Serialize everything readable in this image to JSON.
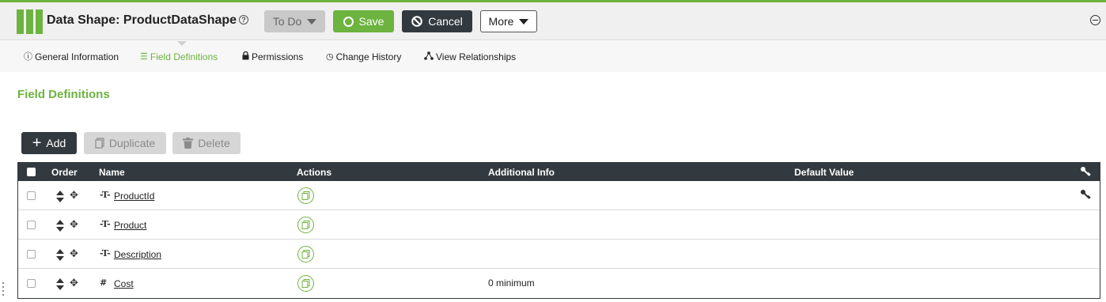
{
  "header": {
    "title": "Data Shape: ProductDataShape",
    "help_glyph": "?",
    "state_label": "To Do",
    "save_label": "Save",
    "cancel_label": "Cancel",
    "more_label": "More",
    "accent": "#6db33f",
    "dark": "#333a3f"
  },
  "tabs": [
    {
      "label": "General Information",
      "icon": "info-icon",
      "glyph": "ⓘ"
    },
    {
      "label": "Field Definitions",
      "icon": "list-icon",
      "glyph": "☰",
      "active": true
    },
    {
      "label": "Permissions",
      "icon": "lock-icon",
      "glyph": "🔒"
    },
    {
      "label": "Change History",
      "icon": "clock-icon",
      "glyph": "◷"
    },
    {
      "label": "View Relationships",
      "icon": "relationship-icon",
      "glyph": "⛓"
    }
  ],
  "section": {
    "title": "Field Definitions"
  },
  "actions": {
    "add_label": "Add",
    "duplicate_label": "Duplicate",
    "delete_label": "Delete"
  },
  "grid": {
    "columns": [
      "Order",
      "Name",
      "Actions",
      "Additional Info",
      "Default Value"
    ],
    "rows": [
      {
        "name": "ProductId",
        "type_glyph": "-T-",
        "additional_info": "",
        "default_value": "",
        "primary_key": true
      },
      {
        "name": "Product",
        "type_glyph": "-T-",
        "additional_info": "",
        "default_value": "",
        "primary_key": false
      },
      {
        "name": "Description",
        "type_glyph": "-T-",
        "additional_info": "",
        "default_value": "",
        "primary_key": false
      },
      {
        "name": "Cost",
        "type_glyph": "#",
        "additional_info": "0 minimum",
        "default_value": "",
        "primary_key": false
      }
    ]
  }
}
